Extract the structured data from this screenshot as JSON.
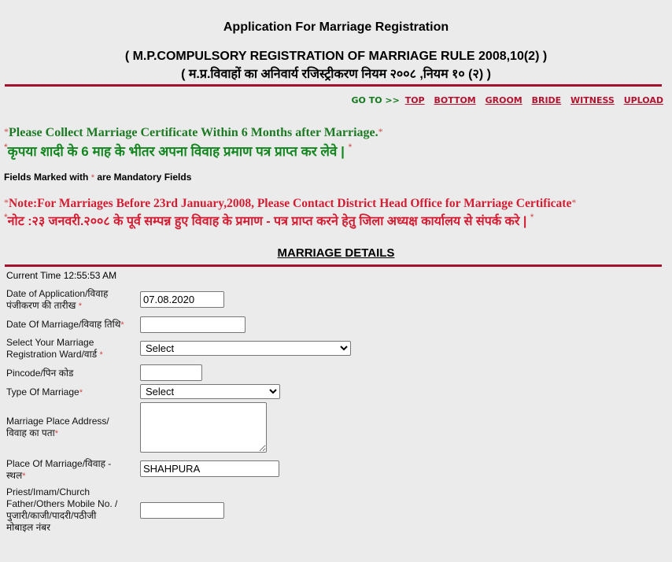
{
  "header": {
    "title": "Application For Marriage Registration",
    "rule_english": "( M.P.COMPULSORY REGISTRATION OF MARRIAGE RULE 2008,10(2) )",
    "rule_hindi": "( म.प्र.विवाहों का अनिवार्य रजिस्ट्रीकरण नियम २००८ ,नियम १० (२) )"
  },
  "goto": {
    "label": "GO TO >>",
    "links": [
      "TOP",
      "BOTTOM",
      "GROOM",
      "BRIDE",
      "WITNESS",
      "UPLOAD"
    ]
  },
  "notices": {
    "collect_english": "Please Collect Marriage Certificate Within 6 Months after Marriage.",
    "collect_hindi": "कृपया शादी के 6 माह के भीतर अपना विवाह प्रमाण पत्र प्राप्त कर लेवे |",
    "mandatory_prefix": "Fields Marked with",
    "mandatory_suffix": "are Mandatory Fields",
    "note_english": "Note:For Marriages Before 23rd January,2008, Please Contact District Head Office for Marriage Certificate",
    "note_hindi": "नोट :२३ जनवरी.२००८ के पूर्व सम्पन्न हुए विवाह के प्रमाण - पत्र प्राप्त करने हेतु जिला अध्यक्ष कार्यालय से संपर्क करे |",
    "star": "*"
  },
  "colors": {
    "accent_rule": "#a3112f",
    "notice_green": "#12861f",
    "note_red": "#d31d33",
    "link_red": "#b5122f",
    "background": "#ebebeb"
  },
  "section": {
    "title": "MARRIAGE DETAILS",
    "current_time_label": "Current Time",
    "current_time_value": "12:55:53 AM"
  },
  "form": {
    "date_of_application": {
      "label_line1": "Date of Application/विवाह",
      "label_line2": "पंजीकरण की तारीख",
      "value": "07.08.2020"
    },
    "date_of_marriage": {
      "label": "Date Of Marriage/विवाह तिथि",
      "value": ""
    },
    "ward": {
      "label_line1": "Select Your Marriage",
      "label_line2": "Registration Ward/वार्ड",
      "selected": "Select"
    },
    "pincode": {
      "label": "Pincode/पिन कोड",
      "value": ""
    },
    "type_of_marriage": {
      "label": "Type Of Marriage",
      "selected": "Select"
    },
    "address": {
      "label_line1": "Marriage Place Address/",
      "label_line2": "विवाह का पता",
      "value": ""
    },
    "place": {
      "label_line1": "Place Of Marriage/विवाह -",
      "label_line2": "स्थल",
      "value": "SHAHPURA"
    },
    "priest_mobile": {
      "label_line1": "Priest/Imam/Church",
      "label_line2": "Father/Others Mobile No. /",
      "label_line3": "पुजारी/काजी/पादरी/पठीजी",
      "label_line4": "मोबाइल नंबर",
      "value": ""
    }
  }
}
